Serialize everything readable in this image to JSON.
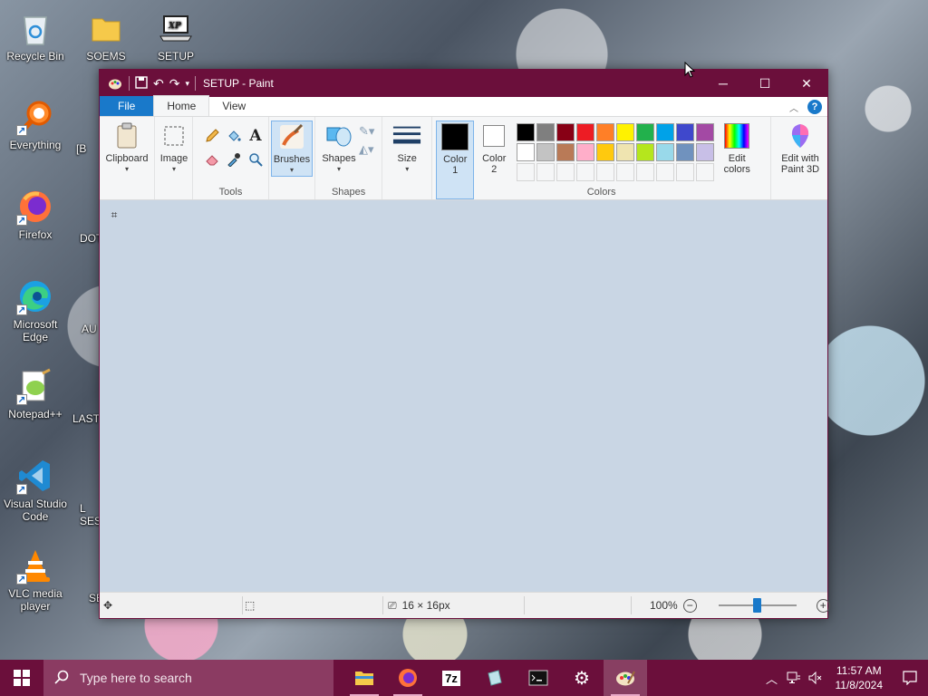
{
  "desktop": {
    "icons": [
      {
        "label": "Recycle Bin",
        "icon": "recycle-bin-icon"
      },
      {
        "label": "SOEMS",
        "icon": "folder-icon"
      },
      {
        "label": "SETUP",
        "icon": "laptop-icon"
      },
      {
        "label": "Everything",
        "icon": "magnifier-icon"
      },
      {
        "label": "Firefox",
        "icon": "firefox-icon"
      },
      {
        "label": "Microsoft Edge",
        "icon": "edge-icon"
      },
      {
        "label": "Notepad++",
        "icon": "notepadpp-icon"
      },
      {
        "label": "Visual Studio Code",
        "icon": "vscode-icon"
      },
      {
        "label": "VLC media player",
        "icon": "vlc-icon"
      }
    ],
    "partial_labels": [
      "[B",
      "DOT",
      "AU",
      "LAST",
      "L SES",
      "SE"
    ]
  },
  "window": {
    "title": "SETUP - Paint",
    "tabs": {
      "file": "File",
      "home": "Home",
      "view": "View"
    },
    "help": "?",
    "ribbon": {
      "clipboard": "Clipboard",
      "image": "Image",
      "tools_label": "Tools",
      "brushes": "Brushes",
      "shapes": "Shapes",
      "shapes_group": "Shapes",
      "size": "Size",
      "color1": "Color 1",
      "color2": "Color 2",
      "colors_group": "Colors",
      "edit_colors": "Edit colors",
      "edit_paint3d": "Edit with Paint 3D"
    },
    "palette_row1": [
      "#000000",
      "#7f7f7f",
      "#880015",
      "#ed1c24",
      "#ff7f27",
      "#fff200",
      "#22b14c",
      "#00a2e8",
      "#3f48cc",
      "#a349a4"
    ],
    "palette_row2": [
      "#ffffff",
      "#c3c3c3",
      "#b97a57",
      "#ffaec9",
      "#ffc90e",
      "#efe4b0",
      "#b5e61d",
      "#99d9ea",
      "#7092be",
      "#c8bfe7"
    ],
    "color1_value": "#000000",
    "color2_value": "#ffffff",
    "status": {
      "dimensions": "16 × 16px",
      "zoom": "100%",
      "zoom_level_percent": 100
    }
  },
  "taskbar": {
    "search_placeholder": "Type here to search",
    "apps": [
      "file-explorer-icon",
      "firefox-icon",
      "7zip-icon",
      "notes-icon",
      "terminal-icon",
      "settings-icon",
      "paint-icon"
    ],
    "seven_zip": "7z",
    "time": "11:57 AM",
    "date": "11/8/2024"
  }
}
